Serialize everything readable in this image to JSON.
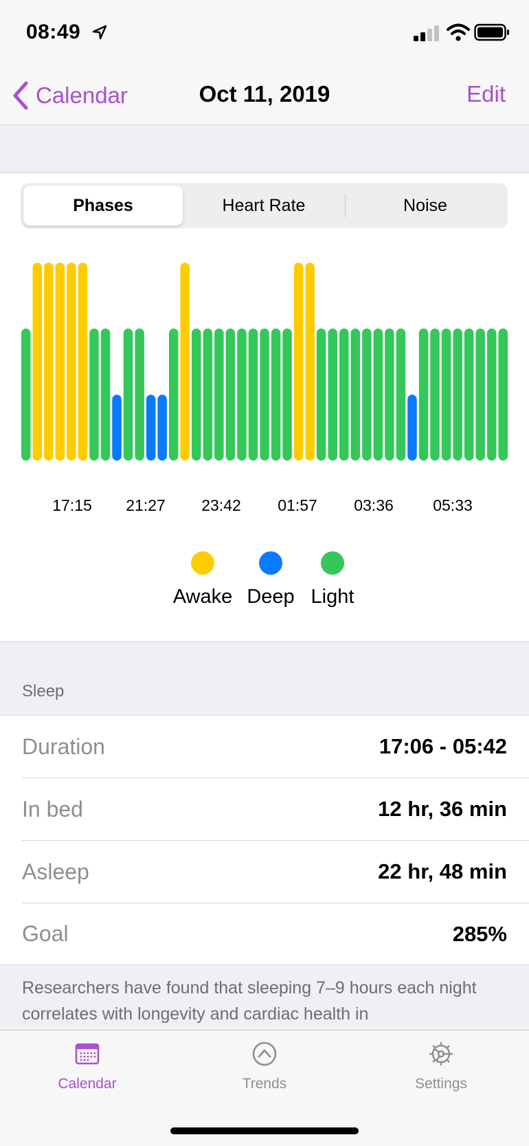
{
  "status": {
    "time": "08:49"
  },
  "nav": {
    "back_label": "Calendar",
    "title": "Oct 11, 2019",
    "edit_label": "Edit"
  },
  "tabs": [
    {
      "label": "Phases",
      "active": true
    },
    {
      "label": "Heart Rate",
      "active": false
    },
    {
      "label": "Noise",
      "active": false
    }
  ],
  "colors": {
    "accent": "#a94fd3",
    "awake": "#ffcc00",
    "deep": "#0a7aff",
    "light": "#34c759"
  },
  "chart_data": {
    "type": "bar",
    "legend": [
      "Awake",
      "Deep",
      "Light"
    ],
    "tick_labels": [
      "17:15",
      "21:27",
      "23:42",
      "01:57",
      "03:36",
      "05:33"
    ],
    "phases": [
      "Light",
      "Awake",
      "Awake",
      "Awake",
      "Awake",
      "Awake",
      "Light",
      "Light",
      "Deep",
      "Light",
      "Light",
      "Deep",
      "Deep",
      "Light",
      "Awake",
      "Light",
      "Light",
      "Light",
      "Light",
      "Light",
      "Light",
      "Light",
      "Light",
      "Light",
      "Awake",
      "Awake",
      "Light",
      "Light",
      "Light",
      "Light",
      "Light",
      "Light",
      "Light",
      "Light",
      "Deep",
      "Light",
      "Light",
      "Light",
      "Light",
      "Light",
      "Light",
      "Light",
      "Light"
    ]
  },
  "sleep": {
    "section_title": "Sleep",
    "rows": [
      {
        "label": "Duration",
        "value": "17:06 - 05:42"
      },
      {
        "label": "In bed",
        "value": "12 hr, 36 min"
      },
      {
        "label": "Asleep",
        "value": "22 hr, 48 min"
      },
      {
        "label": "Goal",
        "value": "285%"
      }
    ],
    "footnote": "Researchers have found that sleeping 7–9 hours each night correlates with longevity and cardiac health in"
  },
  "tabbar": [
    {
      "label": "Calendar",
      "icon": "calendar-icon",
      "active": true
    },
    {
      "label": "Trends",
      "icon": "trends-icon",
      "active": false
    },
    {
      "label": "Settings",
      "icon": "settings-icon",
      "active": false
    }
  ]
}
